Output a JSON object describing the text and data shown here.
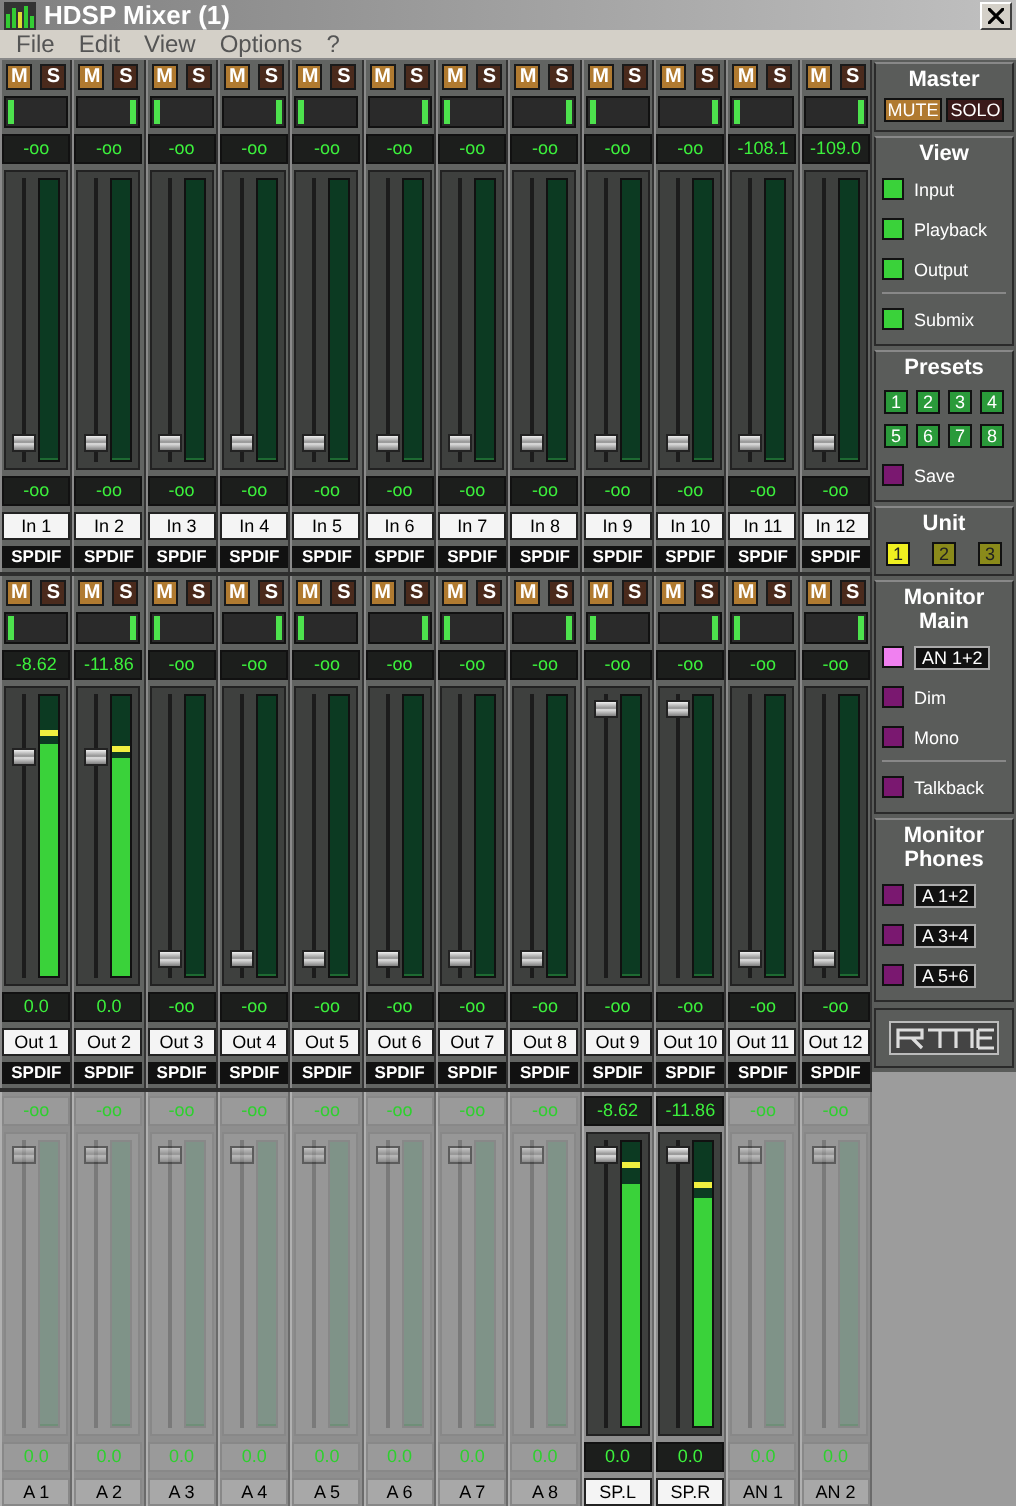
{
  "window": {
    "title": "HDSP Mixer (1)"
  },
  "menu": [
    "File",
    "Edit",
    "View",
    "Options",
    "?"
  ],
  "rows": [
    {
      "kind": "input",
      "channels": [
        {
          "mute": "M",
          "solo": "S",
          "pan_left": true,
          "reading": "-oo",
          "fader": {
            "level": 0.04
          },
          "meter": {
            "level": 0
          },
          "gain": "-oo",
          "name": "In 1",
          "source": "SPDIF",
          "disabled": false
        },
        {
          "mute": "M",
          "solo": "S",
          "pan_left": false,
          "reading": "-oo",
          "fader": {
            "level": 0.04
          },
          "meter": {
            "level": 0
          },
          "gain": "-oo",
          "name": "In 2",
          "source": "SPDIF",
          "disabled": false
        },
        {
          "mute": "M",
          "solo": "S",
          "pan_left": true,
          "reading": "-oo",
          "fader": {
            "level": 0.04
          },
          "meter": {
            "level": 0
          },
          "gain": "-oo",
          "name": "In 3",
          "source": "SPDIF",
          "disabled": false
        },
        {
          "mute": "M",
          "solo": "S",
          "pan_left": false,
          "reading": "-oo",
          "fader": {
            "level": 0.04
          },
          "meter": {
            "level": 0
          },
          "gain": "-oo",
          "name": "In 4",
          "source": "SPDIF",
          "disabled": false
        },
        {
          "mute": "M",
          "solo": "S",
          "pan_left": true,
          "reading": "-oo",
          "fader": {
            "level": 0.04
          },
          "meter": {
            "level": 0
          },
          "gain": "-oo",
          "name": "In 5",
          "source": "SPDIF",
          "disabled": false
        },
        {
          "mute": "M",
          "solo": "S",
          "pan_left": false,
          "reading": "-oo",
          "fader": {
            "level": 0.04
          },
          "meter": {
            "level": 0
          },
          "gain": "-oo",
          "name": "In 6",
          "source": "SPDIF",
          "disabled": false
        },
        {
          "mute": "M",
          "solo": "S",
          "pan_left": true,
          "reading": "-oo",
          "fader": {
            "level": 0.04
          },
          "meter": {
            "level": 0
          },
          "gain": "-oo",
          "name": "In 7",
          "source": "SPDIF",
          "disabled": false
        },
        {
          "mute": "M",
          "solo": "S",
          "pan_left": false,
          "reading": "-oo",
          "fader": {
            "level": 0.04
          },
          "meter": {
            "level": 0
          },
          "gain": "-oo",
          "name": "In 8",
          "source": "SPDIF",
          "disabled": false
        },
        {
          "mute": "M",
          "solo": "S",
          "pan_left": true,
          "reading": "-oo",
          "fader": {
            "level": 0.04
          },
          "meter": {
            "level": 0
          },
          "gain": "-oo",
          "name": "In 9",
          "source": "SPDIF",
          "disabled": false
        },
        {
          "mute": "M",
          "solo": "S",
          "pan_left": false,
          "reading": "-oo",
          "fader": {
            "level": 0.04
          },
          "meter": {
            "level": 0
          },
          "gain": "-oo",
          "name": "In 10",
          "source": "SPDIF",
          "disabled": false
        },
        {
          "mute": "M",
          "solo": "S",
          "pan_left": true,
          "reading": "-108.1",
          "fader": {
            "level": 0.04
          },
          "meter": {
            "level": 0
          },
          "gain": "-oo",
          "name": "In 11",
          "source": "SPDIF",
          "disabled": false
        },
        {
          "mute": "M",
          "solo": "S",
          "pan_left": false,
          "reading": "-109.0",
          "fader": {
            "level": 0.04
          },
          "meter": {
            "level": 0
          },
          "gain": "-oo",
          "name": "In 12",
          "source": "SPDIF",
          "disabled": false
        }
      ]
    },
    {
      "kind": "playback",
      "channels": [
        {
          "mute": "M",
          "solo": "S",
          "pan_left": true,
          "reading": "-8.62",
          "fader": {
            "level": 0.8
          },
          "meter": {
            "level": 0.83
          },
          "peak_hold": {
            "level": 0.88
          },
          "gain": "0.0",
          "name": "Out 1",
          "source": "SPDIF",
          "disabled": false
        },
        {
          "mute": "M",
          "solo": "S",
          "pan_left": false,
          "reading": "-11.86",
          "fader": {
            "level": 0.8
          },
          "meter": {
            "level": 0.78
          },
          "peak_hold": {
            "level": 0.82
          },
          "gain": "0.0",
          "name": "Out 2",
          "source": "SPDIF",
          "disabled": false
        },
        {
          "mute": "M",
          "solo": "S",
          "pan_left": true,
          "reading": "-oo",
          "fader": {
            "level": 0.04
          },
          "meter": {
            "level": 0
          },
          "gain": "-oo",
          "name": "Out 3",
          "source": "SPDIF",
          "disabled": false
        },
        {
          "mute": "M",
          "solo": "S",
          "pan_left": false,
          "reading": "-oo",
          "fader": {
            "level": 0.04
          },
          "meter": {
            "level": 0
          },
          "gain": "-oo",
          "name": "Out 4",
          "source": "SPDIF",
          "disabled": false
        },
        {
          "mute": "M",
          "solo": "S",
          "pan_left": true,
          "reading": "-oo",
          "fader": {
            "level": 0.04
          },
          "meter": {
            "level": 0
          },
          "gain": "-oo",
          "name": "Out 5",
          "source": "SPDIF",
          "disabled": false
        },
        {
          "mute": "M",
          "solo": "S",
          "pan_left": false,
          "reading": "-oo",
          "fader": {
            "level": 0.04
          },
          "meter": {
            "level": 0
          },
          "gain": "-oo",
          "name": "Out 6",
          "source": "SPDIF",
          "disabled": false
        },
        {
          "mute": "M",
          "solo": "S",
          "pan_left": true,
          "reading": "-oo",
          "fader": {
            "level": 0.04
          },
          "meter": {
            "level": 0
          },
          "gain": "-oo",
          "name": "Out 7",
          "source": "SPDIF",
          "disabled": false
        },
        {
          "mute": "M",
          "solo": "S",
          "pan_left": false,
          "reading": "-oo",
          "fader": {
            "level": 0.04
          },
          "meter": {
            "level": 0
          },
          "gain": "-oo",
          "name": "Out 8",
          "source": "SPDIF",
          "disabled": false
        },
        {
          "mute": "M",
          "solo": "S",
          "pan_left": true,
          "reading": "-oo",
          "fader": {
            "level": 0.98
          },
          "meter": {
            "level": 0
          },
          "gain": "-oo",
          "name": "Out 9",
          "source": "SPDIF",
          "disabled": false
        },
        {
          "mute": "M",
          "solo": "S",
          "pan_left": false,
          "reading": "-oo",
          "fader": {
            "level": 0.98
          },
          "meter": {
            "level": 0
          },
          "gain": "-oo",
          "name": "Out 10",
          "source": "SPDIF",
          "disabled": false
        },
        {
          "mute": "M",
          "solo": "S",
          "pan_left": true,
          "reading": "-oo",
          "fader": {
            "level": 0.04
          },
          "meter": {
            "level": 0
          },
          "gain": "-oo",
          "name": "Out 11",
          "source": "SPDIF",
          "disabled": false
        },
        {
          "mute": "M",
          "solo": "S",
          "pan_left": false,
          "reading": "-oo",
          "fader": {
            "level": 0.04
          },
          "meter": {
            "level": 0
          },
          "gain": "-oo",
          "name": "Out 12",
          "source": "SPDIF",
          "disabled": false
        }
      ]
    },
    {
      "kind": "output",
      "channels": [
        {
          "reading": "-oo",
          "fader": {
            "level": 0.98
          },
          "meter": {
            "level": 0
          },
          "gain": "0.0",
          "name": "A 1",
          "disabled": true
        },
        {
          "reading": "-oo",
          "fader": {
            "level": 0.98
          },
          "meter": {
            "level": 0
          },
          "gain": "0.0",
          "name": "A 2",
          "disabled": true
        },
        {
          "reading": "-oo",
          "fader": {
            "level": 0.98
          },
          "meter": {
            "level": 0
          },
          "gain": "0.0",
          "name": "A 3",
          "disabled": true
        },
        {
          "reading": "-oo",
          "fader": {
            "level": 0.98
          },
          "meter": {
            "level": 0
          },
          "gain": "0.0",
          "name": "A 4",
          "disabled": true
        },
        {
          "reading": "-oo",
          "fader": {
            "level": 0.98
          },
          "meter": {
            "level": 0
          },
          "gain": "0.0",
          "name": "A 5",
          "disabled": true
        },
        {
          "reading": "-oo",
          "fader": {
            "level": 0.98
          },
          "meter": {
            "level": 0
          },
          "gain": "0.0",
          "name": "A 6",
          "disabled": true
        },
        {
          "reading": "-oo",
          "fader": {
            "level": 0.98
          },
          "meter": {
            "level": 0
          },
          "gain": "0.0",
          "name": "A 7",
          "disabled": true
        },
        {
          "reading": "-oo",
          "fader": {
            "level": 0.98
          },
          "meter": {
            "level": 0
          },
          "gain": "0.0",
          "name": "A 8",
          "disabled": true
        },
        {
          "reading": "-8.62",
          "fader": {
            "level": 0.98
          },
          "meter": {
            "level": 0.85
          },
          "peak_hold": {
            "level": 0.93
          },
          "gain": "0.0",
          "name": "SP.L",
          "disabled": false
        },
        {
          "reading": "-11.86",
          "fader": {
            "level": 0.98
          },
          "meter": {
            "level": 0.8
          },
          "peak_hold": {
            "level": 0.86
          },
          "gain": "0.0",
          "name": "SP.R",
          "disabled": false
        },
        {
          "reading": "-oo",
          "fader": {
            "level": 0.98
          },
          "meter": {
            "level": 0
          },
          "gain": "0.0",
          "name": "AN 1",
          "disabled": true
        },
        {
          "reading": "-oo",
          "fader": {
            "level": 0.98
          },
          "meter": {
            "level": 0
          },
          "gain": "0.0",
          "name": "AN 2",
          "disabled": true
        }
      ]
    }
  ],
  "master": {
    "title": "Master",
    "buttons": [
      {
        "label": "MUTE",
        "on": true
      },
      {
        "label": "SOLO",
        "on": false
      }
    ]
  },
  "view": {
    "title": "View",
    "items": [
      {
        "label": "Input",
        "on": true
      },
      {
        "label": "Playback",
        "on": true
      },
      {
        "label": "Output",
        "on": true
      },
      {
        "label": "Submix",
        "on": true
      }
    ]
  },
  "presets": {
    "title": "Presets",
    "buttons": [
      "1",
      "2",
      "3",
      "4",
      "5",
      "6",
      "7",
      "8"
    ],
    "save": "Save"
  },
  "unit": {
    "title": "Unit",
    "buttons": [
      {
        "label": "1",
        "selected": true
      },
      {
        "label": "2",
        "selected": false
      },
      {
        "label": "3",
        "selected": false
      }
    ]
  },
  "monitor_main": {
    "title_lines": [
      "Monitor",
      "Main"
    ],
    "items": [
      {
        "kind": "select",
        "label": "AN 1+2",
        "on": true
      },
      {
        "kind": "toggle",
        "label": "Dim",
        "on": false
      },
      {
        "kind": "toggle",
        "label": "Mono",
        "on": false
      },
      {
        "kind": "toggle",
        "label": "Talkback",
        "on": false
      }
    ]
  },
  "monitor_phones": {
    "title_lines": [
      "Monitor",
      "Phones"
    ],
    "items": [
      {
        "kind": "select",
        "label": "A 1+2",
        "on": false
      },
      {
        "kind": "select",
        "label": "A 3+4",
        "on": false
      },
      {
        "kind": "select",
        "label": "A 5+6",
        "on": false
      }
    ]
  }
}
